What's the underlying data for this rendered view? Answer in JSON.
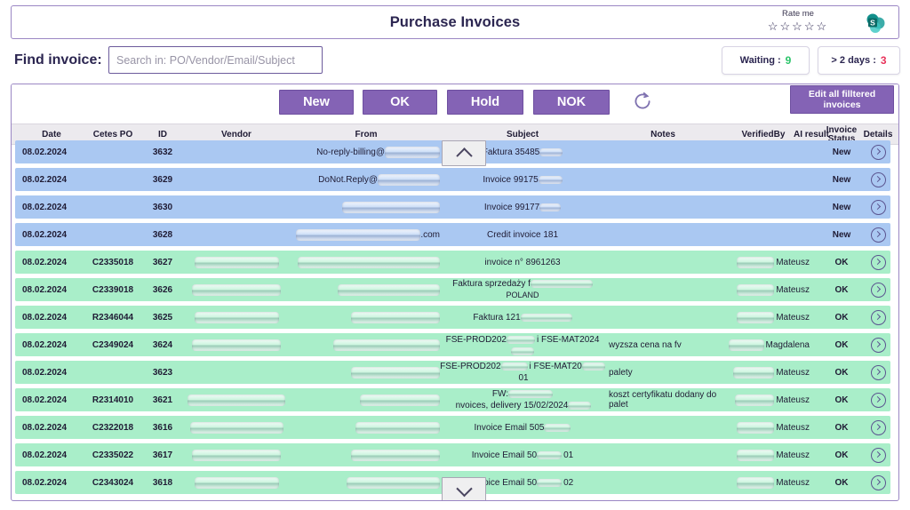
{
  "header": {
    "title": "Purchase Invoices",
    "rate_label": "Rate me",
    "stars": "☆☆☆☆☆",
    "logo_icon": "sharepoint-logo"
  },
  "search": {
    "label": "Find invoice:",
    "placeholder": "Search in: PO/Vendor/Email/Subject",
    "value": ""
  },
  "counters": [
    {
      "label": "Waiting :",
      "value": "9",
      "color": "#2bc46a"
    },
    {
      "label": "> 2 days :",
      "value": "3",
      "color": "#e8325a"
    }
  ],
  "toolbar": {
    "new_label": "New",
    "ok_label": "OK",
    "hold_label": "Hold",
    "nok_label": "NOK",
    "refresh_icon": "refresh-icon",
    "edit_all_label": "Edit all filltered invoices"
  },
  "table": {
    "columns": [
      {
        "key": "date",
        "label": "Date"
      },
      {
        "key": "cetes_po",
        "label": "Cetes PO"
      },
      {
        "key": "id",
        "label": "ID"
      },
      {
        "key": "vendor",
        "label": "Vendor"
      },
      {
        "key": "from",
        "label": "From"
      },
      {
        "key": "subject",
        "label": "Subject"
      },
      {
        "key": "notes",
        "label": "Notes"
      },
      {
        "key": "verified",
        "label": "VerifiedBy"
      },
      {
        "key": "ai",
        "label": "AI result"
      },
      {
        "key": "status",
        "label": "Invoice Status"
      },
      {
        "key": "details",
        "label": "Details"
      }
    ],
    "rows": [
      {
        "date": "08.02.2024",
        "cetes_po": "",
        "id": "3632",
        "vendor": "",
        "from": "No-reply-billing@",
        "from_redacted": 62,
        "subject": "Faktura 35485",
        "subject_redacted": 26,
        "notes": "",
        "verified": "",
        "verified_redacted": 0,
        "ai": "",
        "status": "New",
        "state": "new"
      },
      {
        "date": "08.02.2024",
        "cetes_po": "",
        "id": "3629",
        "vendor": "",
        "from": "DoNot.Reply@",
        "from_redacted": 70,
        "subject": "Invoice 99175",
        "subject_redacted": 27,
        "notes": "",
        "verified": "",
        "verified_redacted": 0,
        "ai": "",
        "status": "New",
        "state": "new"
      },
      {
        "date": "08.02.2024",
        "cetes_po": "",
        "id": "3630",
        "vendor": "",
        "from": "",
        "from_redacted": 110,
        "subject": "Invoice 99177",
        "subject_redacted": 24,
        "notes": "",
        "verified": "",
        "verified_redacted": 0,
        "ai": "",
        "status": "New",
        "state": "new"
      },
      {
        "date": "08.02.2024",
        "cetes_po": "",
        "id": "3628",
        "vendor": "",
        "from": "",
        "from_redacted": 140,
        "from_suffix": ".com",
        "subject": "Credit invoice 181",
        "subject_redacted": 0,
        "notes": "",
        "verified": "",
        "verified_redacted": 0,
        "ai": "",
        "status": "New",
        "state": "new"
      },
      {
        "date": "08.02.2024",
        "cetes_po": "C2335018",
        "id": "3627",
        "vendor": "",
        "vendor_redacted": 95,
        "from": "",
        "from_redacted": 165,
        "subject": "invoice n° 8961263",
        "subject_redacted": 0,
        "notes": "",
        "verified": "Mateusz",
        "verified_redacted": 42,
        "ai": "",
        "status": "OK",
        "state": "ok"
      },
      {
        "date": "08.02.2024",
        "cetes_po": "C2339018",
        "id": "3626",
        "vendor": "",
        "vendor_redacted": 100,
        "from": "",
        "from_redacted": 115,
        "subject": "Faktura sprzedaży f",
        "subject_redacted": 90,
        "subject_line2": "POLAND",
        "notes": "",
        "verified": "Mateusz",
        "verified_redacted": 42,
        "ai": "",
        "status": "OK",
        "state": "ok"
      },
      {
        "date": "08.02.2024",
        "cetes_po": "R2346044",
        "id": "3625",
        "vendor": "",
        "vendor_redacted": 95,
        "from": "",
        "from_redacted": 100,
        "subject": "Faktura 121",
        "subject_redacted": 58,
        "notes": "",
        "verified": "Mateusz",
        "verified_redacted": 42,
        "ai": "",
        "status": "OK",
        "state": "ok"
      },
      {
        "date": "08.02.2024",
        "cetes_po": "C2349024",
        "id": "3624",
        "vendor": "",
        "vendor_redacted": 100,
        "from": "",
        "from_redacted": 120,
        "subject": "FSE-PROD202",
        "subject_mid": "i FSE-MAT2024",
        "subject_redacted": 32,
        "notes": "wyzsza cena na fv",
        "verified": "Magdalena",
        "verified_redacted": 40,
        "ai": "",
        "status": "OK",
        "state": "ok"
      },
      {
        "date": "08.02.2024",
        "cetes_po": "",
        "id": "3623",
        "vendor": "",
        "vendor_redacted": 0,
        "from": "",
        "from_redacted": 100,
        "subject": "FSE-PROD202",
        "subject_mid": "i FSE-MAT20",
        "subject_suffix": "01",
        "subject_redacted": 30,
        "notes": "palety",
        "verified": "Mateusz",
        "verified_redacted": 46,
        "ai": "",
        "status": "OK",
        "state": "ok"
      },
      {
        "date": "08.02.2024",
        "cetes_po": "R2314010",
        "id": "3621",
        "vendor": "",
        "vendor_redacted": 110,
        "from": "",
        "from_redacted": 90,
        "subject": "FW:",
        "subject_mid": "nvoices, delivery 15/02/2024",
        "subject_redacted": 50,
        "notes": "koszt certyfikatu dodany do palet",
        "verified": "Mateusz",
        "verified_redacted": 44,
        "ai": "",
        "status": "OK",
        "state": "ok"
      },
      {
        "date": "08.02.2024",
        "cetes_po": "C2322018",
        "id": "3616",
        "vendor": "",
        "vendor_redacted": 105,
        "from": "",
        "from_redacted": 95,
        "subject": "Invoice Email 505",
        "subject_redacted": 30,
        "notes": "",
        "verified": "Mateusz",
        "verified_redacted": 42,
        "ai": "",
        "status": "OK",
        "state": "ok"
      },
      {
        "date": "08.02.2024",
        "cetes_po": "C2335022",
        "id": "3617",
        "vendor": "",
        "vendor_redacted": 100,
        "from": "",
        "from_redacted": 100,
        "subject": "Invoice Email 50",
        "subject_suffix": "01",
        "subject_redacted": 28,
        "notes": "",
        "verified": "Mateusz",
        "verified_redacted": 42,
        "ai": "",
        "status": "OK",
        "state": "ok"
      },
      {
        "date": "08.02.2024",
        "cetes_po": "C2343024",
        "id": "3618",
        "vendor": "",
        "vendor_redacted": 95,
        "from": "",
        "from_redacted": 105,
        "subject": "Invoice Email 50",
        "subject_suffix": "02",
        "subject_redacted": 28,
        "notes": "",
        "verified": "Mateusz",
        "verified_redacted": 42,
        "ai": "",
        "status": "OK",
        "state": "ok"
      }
    ]
  },
  "scroll": {
    "up_icon": "chevron-up-icon",
    "down_icon": "chevron-down-icon"
  }
}
